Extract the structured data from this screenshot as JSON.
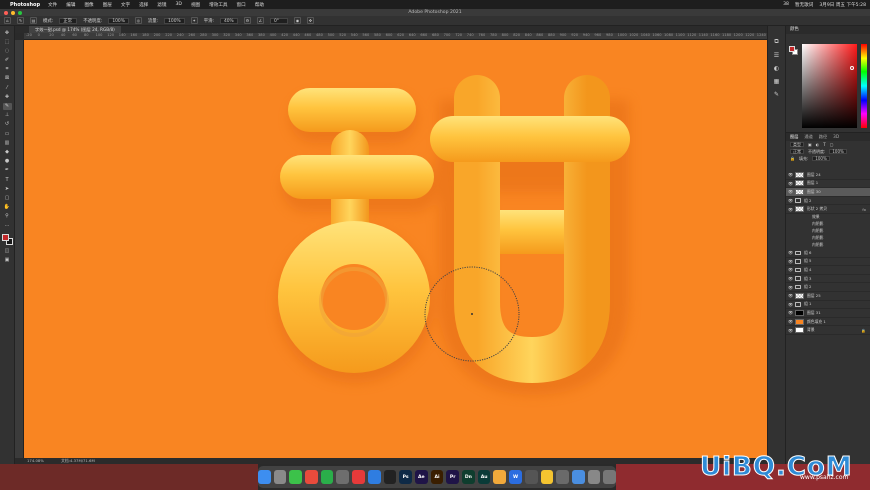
{
  "menubar": {
    "apple": "",
    "app": "Photoshop",
    "items": [
      "文件",
      "编辑",
      "图像",
      "图层",
      "文字",
      "选择",
      "滤镜",
      "3D",
      "视图",
      "增效工具",
      "窗口",
      "帮助"
    ],
    "right": [
      "38",
      "暂无歌词",
      "3月9日 周五 下午5:28"
    ]
  },
  "window": {
    "title": "Adobe Photoshop 2021"
  },
  "options": {
    "mode_label": "模式:",
    "mode_value": "正常",
    "opacity_label": "不透明度:",
    "opacity_value": "100%",
    "flow_label": "流量:",
    "flow_value": "100%",
    "smooth_label": "平滑:",
    "smooth_value": "40%",
    "angle_value": "0°"
  },
  "document": {
    "tab": "字效一甜.psd @ 174% (图层 24, RGB/8)",
    "ruler_ticks": [
      "-20",
      "0",
      "20",
      "40",
      "60",
      "80",
      "100",
      "120",
      "140",
      "160",
      "180",
      "200",
      "220",
      "240",
      "260",
      "280",
      "300",
      "320",
      "340",
      "360",
      "380",
      "400",
      "420",
      "440",
      "460",
      "480",
      "500",
      "520",
      "540",
      "560",
      "580",
      "600",
      "620",
      "640",
      "660",
      "680",
      "700",
      "720",
      "740",
      "760",
      "780",
      "800",
      "820",
      "840",
      "860",
      "880",
      "900",
      "920",
      "940",
      "960",
      "980",
      "1000",
      "1020",
      "1040",
      "1060",
      "1080",
      "1100",
      "1120",
      "1140",
      "1160",
      "1180",
      "1200",
      "1220",
      "1240",
      "1260",
      "1280",
      "1300"
    ],
    "zoom": "174.08%",
    "doc_size": "文档:4.37M/71.6M"
  },
  "colors": {
    "canvas_bg": "#f98522",
    "foreground": "#c3282a",
    "background": "#1a1a1a"
  },
  "panels": {
    "color_title": "颜色",
    "layer_tabs": [
      "图层",
      "通道",
      "路径",
      "3D"
    ],
    "kind_label": "类型",
    "blend_mode": "正常",
    "opacity_label": "不透明度:",
    "opacity_value": "100%",
    "fill_label": "填充:",
    "fill_value": "100%",
    "layers": [
      {
        "name": "图层 24",
        "type": "layer"
      },
      {
        "name": "图层 1",
        "type": "layer"
      },
      {
        "name": "图层 30",
        "type": "layer",
        "selected": true
      },
      {
        "name": "组 2",
        "type": "group"
      },
      {
        "name": "形状 2 拷贝",
        "type": "layer",
        "fx": true
      },
      {
        "name": "效果",
        "type": "effects"
      },
      {
        "name": "内阴影",
        "type": "effect"
      },
      {
        "name": "内阴影",
        "type": "effect"
      },
      {
        "name": "内阴影",
        "type": "effect"
      },
      {
        "name": "内阴影",
        "type": "effect"
      },
      {
        "name": "组 6",
        "type": "group"
      },
      {
        "name": "组 5",
        "type": "group"
      },
      {
        "name": "组 4",
        "type": "group"
      },
      {
        "name": "组 3",
        "type": "group"
      },
      {
        "name": "组 2",
        "type": "group"
      },
      {
        "name": "图层 25",
        "type": "layer"
      },
      {
        "name": "组 1",
        "type": "group"
      },
      {
        "name": "图层 31",
        "type": "layer-black"
      },
      {
        "name": "颜色填充 1",
        "type": "fill"
      },
      {
        "name": "背景",
        "type": "background"
      }
    ]
  },
  "dock": {
    "apps": [
      {
        "label": "",
        "color": "#3d8ef0"
      },
      {
        "label": "",
        "color": "#8a8a8a"
      },
      {
        "label": "",
        "color": "#3cc24a"
      },
      {
        "label": "",
        "color": "#e94b3c"
      },
      {
        "label": "",
        "color": "#2aae4a"
      },
      {
        "label": "",
        "color": "#6e6e6e"
      },
      {
        "label": "",
        "color": "#e63a3a"
      },
      {
        "label": "",
        "color": "#2f7de1"
      },
      {
        "label": "",
        "color": "#222222"
      },
      {
        "label": "Ps",
        "color": "#0e2a47"
      },
      {
        "label": "Ae",
        "color": "#1f1447"
      },
      {
        "label": "Ai",
        "color": "#3a1e00"
      },
      {
        "label": "Pr",
        "color": "#1f1447"
      },
      {
        "label": "Dn",
        "color": "#0f3d2e"
      },
      {
        "label": "Au",
        "color": "#0a3b38"
      },
      {
        "label": "",
        "color": "#f2a93b"
      },
      {
        "label": "W",
        "color": "#2b6de0"
      },
      {
        "label": "",
        "color": "#555555"
      },
      {
        "label": "",
        "color": "#f4c430"
      },
      {
        "label": "",
        "color": "#6a6a6a"
      },
      {
        "label": "",
        "color": "#4a8ee0"
      },
      {
        "label": "",
        "color": "#888888"
      },
      {
        "label": "",
        "color": "#777777"
      }
    ]
  },
  "watermark": {
    "logo": "UiBQ.CoM",
    "url": "www.psahz.com"
  }
}
